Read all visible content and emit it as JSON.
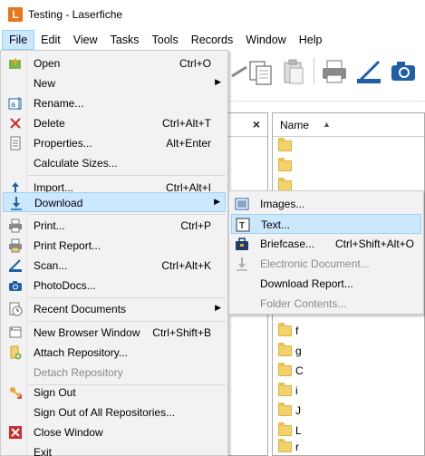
{
  "window": {
    "app_icon_letter": "L",
    "title": "Testing - Laserfiche"
  },
  "menubar": [
    "File",
    "Edit",
    "View",
    "Tasks",
    "Tools",
    "Records",
    "Window",
    "Help"
  ],
  "file_menu": {
    "items": [
      {
        "label": "Open",
        "shortcut": "Ctrl+O",
        "icon": "open-icon"
      },
      {
        "label": "New",
        "shortcut": "",
        "icon": "",
        "submenu": true
      },
      {
        "label": "Rename...",
        "shortcut": "",
        "icon": "rename-icon"
      },
      {
        "label": "Delete",
        "shortcut": "Ctrl+Alt+T",
        "icon": "delete-icon"
      },
      {
        "label": "Properties...",
        "shortcut": "Alt+Enter",
        "icon": "properties-icon"
      },
      {
        "label": "Calculate Sizes...",
        "shortcut": "",
        "icon": ""
      },
      {
        "label": "Import...",
        "shortcut": "Ctrl+Alt+I",
        "icon": "import-icon"
      },
      {
        "label": "Download",
        "shortcut": "",
        "icon": "download-icon",
        "submenu": true
      },
      {
        "label": "Print...",
        "shortcut": "Ctrl+P",
        "icon": "print-icon"
      },
      {
        "label": "Print Report...",
        "shortcut": "",
        "icon": "print-report-icon"
      },
      {
        "label": "Scan...",
        "shortcut": "Ctrl+Alt+K",
        "icon": "scan-icon"
      },
      {
        "label": "PhotoDocs...",
        "shortcut": "",
        "icon": "camera-icon"
      },
      {
        "label": "Recent Documents",
        "shortcut": "",
        "icon": "recent-documents-icon",
        "submenu": true
      },
      {
        "label": "New Browser Window",
        "shortcut": "Ctrl+Shift+B",
        "icon": "new-window-icon"
      },
      {
        "label": "Attach Repository...",
        "shortcut": "",
        "icon": "attach-repository-icon"
      },
      {
        "label": "Detach Repository",
        "shortcut": "",
        "icon": ""
      },
      {
        "label": "Sign Out",
        "shortcut": "",
        "icon": "sign-out-icon"
      },
      {
        "label": "Sign Out of All Repositories...",
        "shortcut": "",
        "icon": ""
      },
      {
        "label": "Close Window",
        "shortcut": "",
        "icon": "close-window-icon"
      },
      {
        "label": "Exit",
        "shortcut": "",
        "icon": ""
      }
    ]
  },
  "download_submenu": {
    "items": [
      {
        "label": "Images...",
        "shortcut": "",
        "icon": "images-icon"
      },
      {
        "label": "Text...",
        "shortcut": "",
        "icon": "text-icon"
      },
      {
        "label": "Briefcase...",
        "shortcut": "Ctrl+Shift+Alt+O",
        "icon": "briefcase-icon"
      },
      {
        "label": "Electronic Document...",
        "shortcut": "",
        "icon": "electronic-document-icon"
      },
      {
        "label": "Download Report...",
        "shortcut": "",
        "icon": ""
      },
      {
        "label": "Folder Contents...",
        "shortcut": "",
        "icon": ""
      }
    ]
  },
  "right_pane": {
    "column_name": "Name",
    "sort_arrow": "▲",
    "visible_fragments": [
      "f",
      "g",
      "C",
      "i",
      "J",
      "L",
      "r"
    ]
  },
  "left_pane": {
    "close_glyph": "×"
  },
  "colors": {
    "highlight": "#cce8ff",
    "highlight_border": "#99d1ff",
    "menu_bg": "#f2f2f2",
    "accent": "#1e5fa8",
    "brand": "#e8751a"
  }
}
